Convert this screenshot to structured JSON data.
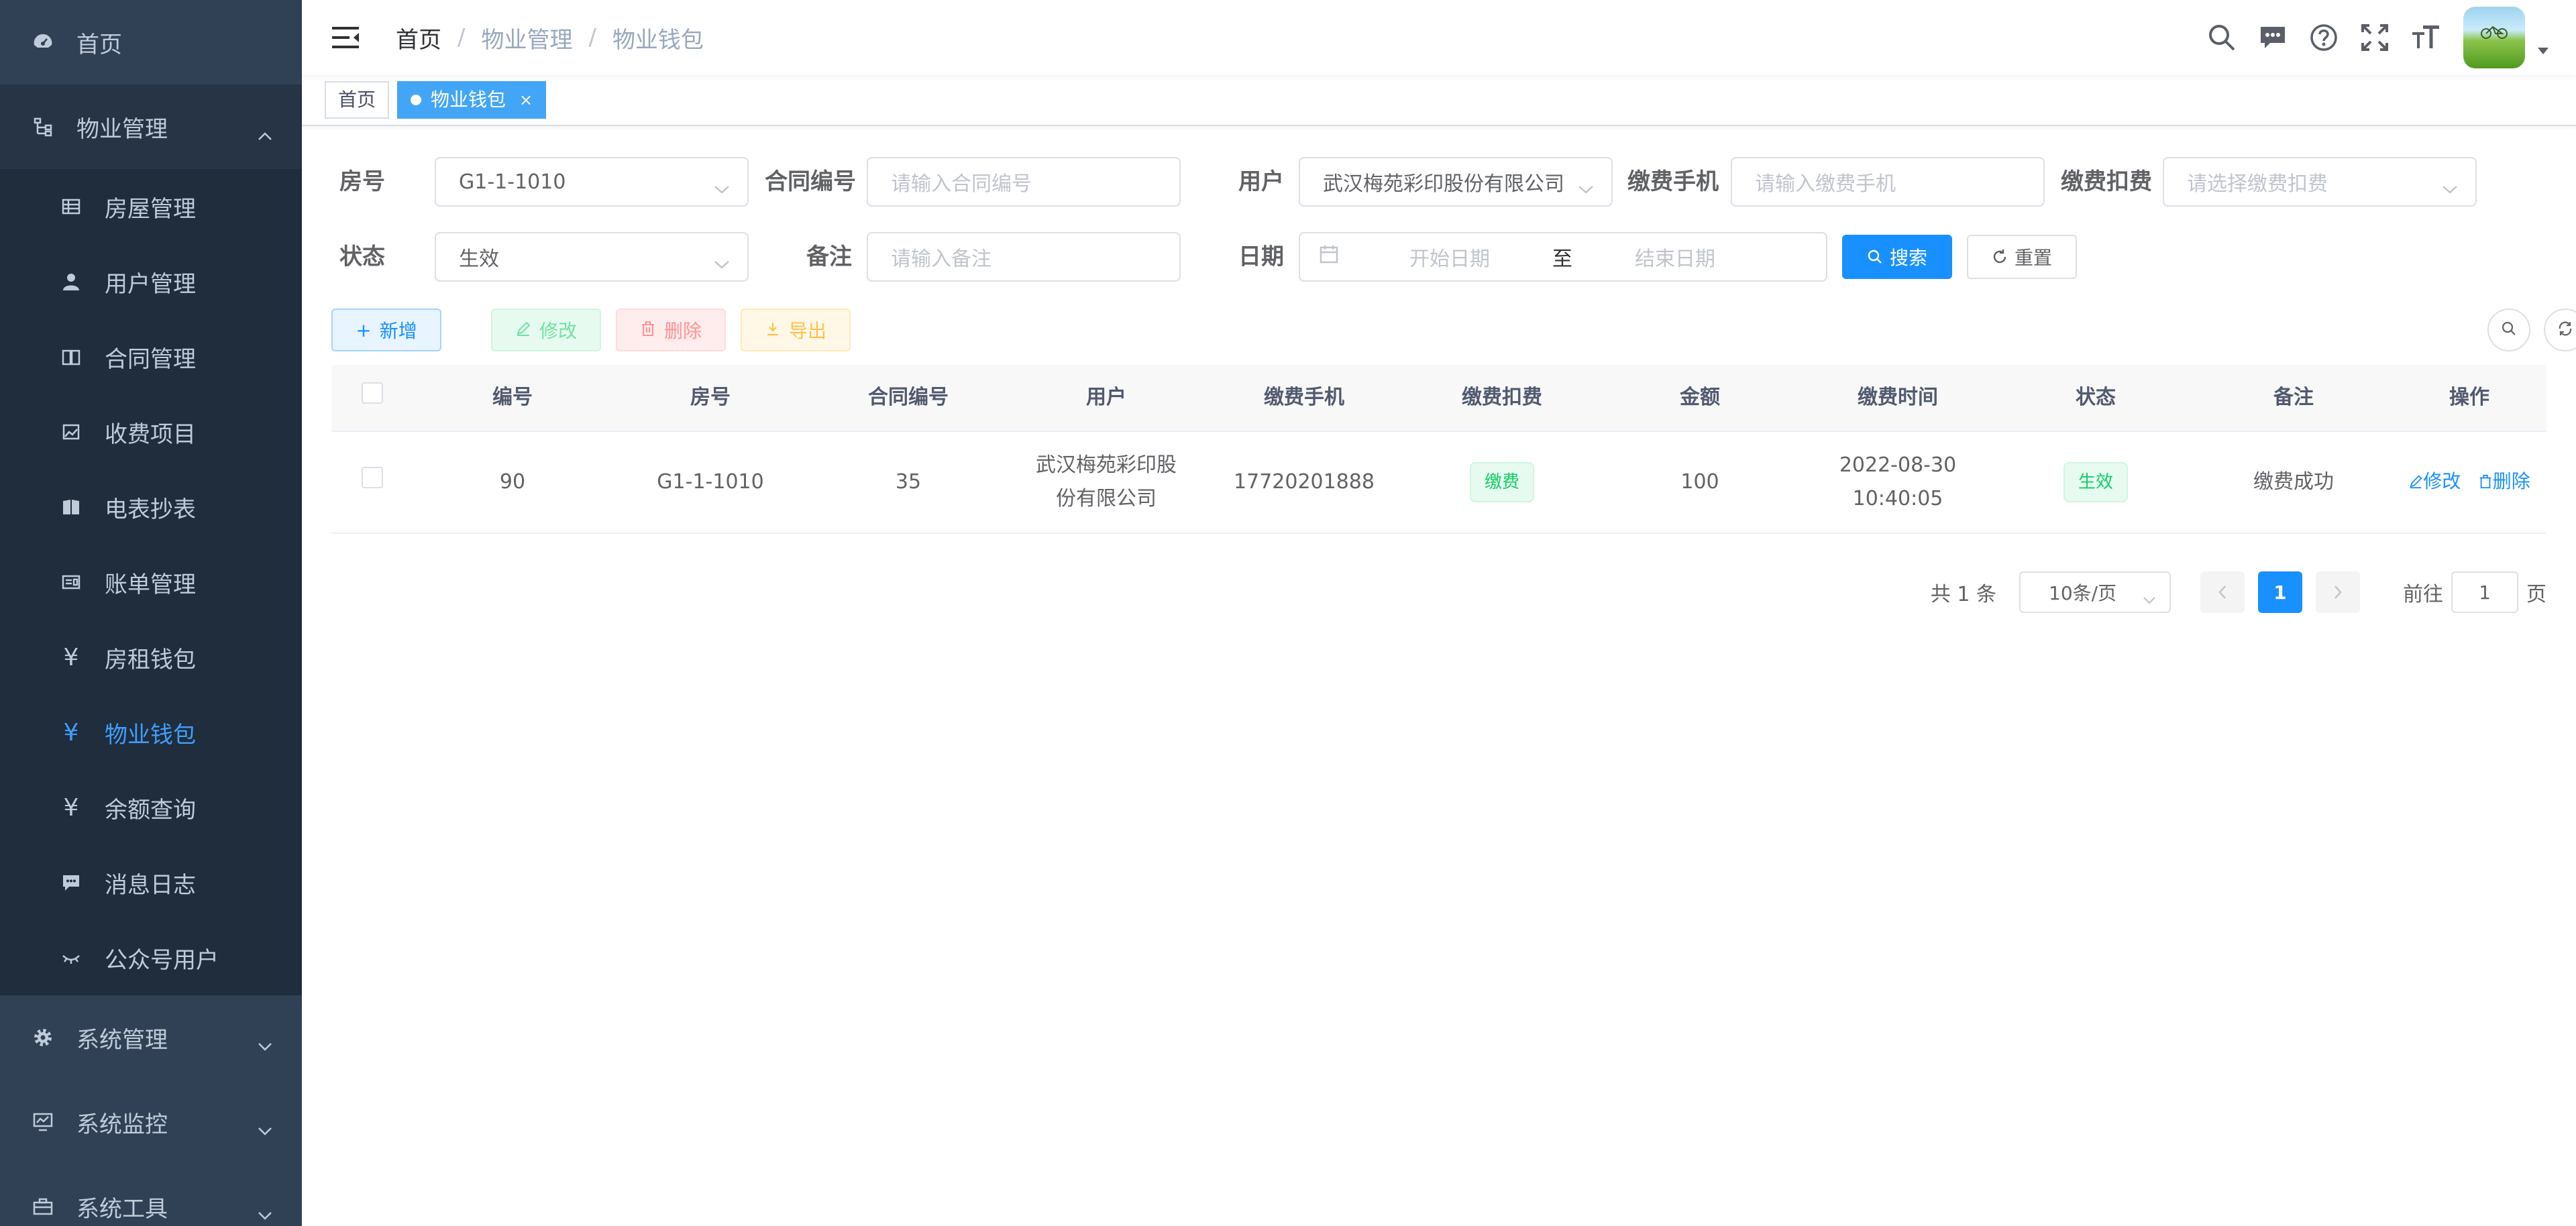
{
  "sidebar": {
    "items": [
      {
        "label": "首页",
        "icon": "dashboard-icon"
      },
      {
        "label": "物业管理",
        "icon": "tree-icon",
        "expanded": true
      },
      {
        "label": "系统管理",
        "icon": "gear-icon"
      },
      {
        "label": "系统监控",
        "icon": "monitor-icon"
      },
      {
        "label": "系统工具",
        "icon": "toolbox-icon"
      }
    ],
    "sub_items": [
      {
        "label": "房屋管理",
        "icon": "table-icon"
      },
      {
        "label": "用户管理",
        "icon": "user-icon"
      },
      {
        "label": "合同管理",
        "icon": "book-icon"
      },
      {
        "label": "收费项目",
        "icon": "image-icon"
      },
      {
        "label": "电表抄表",
        "icon": "reader-icon"
      },
      {
        "label": "账单管理",
        "icon": "bill-icon"
      },
      {
        "label": "房租钱包",
        "icon": "yuan-icon"
      },
      {
        "label": "物业钱包",
        "icon": "yuan-icon",
        "active": true
      },
      {
        "label": "余额查询",
        "icon": "yuan-icon"
      },
      {
        "label": "消息日志",
        "icon": "message-icon"
      },
      {
        "label": "公众号用户",
        "icon": "eye-closed-icon"
      }
    ]
  },
  "navbar": {
    "breadcrumb": [
      "首页",
      "物业管理",
      "物业钱包"
    ],
    "separator": "/"
  },
  "tags": [
    {
      "label": "首页",
      "active": false
    },
    {
      "label": "物业钱包",
      "active": true,
      "close": "×"
    }
  ],
  "filters": {
    "room_label": "房号",
    "room_value": "G1-1-1010",
    "contract_label": "合同编号",
    "contract_placeholder": "请输入合同编号",
    "user_label": "用户",
    "user_value": "武汉梅苑彩印股份有限公司",
    "phone_label": "缴费手机",
    "phone_placeholder": "请输入缴费手机",
    "deduct_label": "缴费扣费",
    "deduct_placeholder": "请选择缴费扣费",
    "status_label": "状态",
    "status_value": "生效",
    "remark_label": "备注",
    "remark_placeholder": "请输入备注",
    "date_label": "日期",
    "date_start": "开始日期",
    "date_to": "至",
    "date_end": "结束日期",
    "search_label": "搜索",
    "reset_label": "重置"
  },
  "toolbar": {
    "add": "新增",
    "edit": "修改",
    "delete": "删除",
    "export": "导出"
  },
  "table": {
    "columns": [
      "编号",
      "房号",
      "合同编号",
      "用户",
      "缴费手机",
      "缴费扣费",
      "金额",
      "缴费时间",
      "状态",
      "备注",
      "操作"
    ],
    "rows": [
      {
        "id": "90",
        "room": "G1-1-1010",
        "contract": "35",
        "user_line1": "武汉梅苑彩印股",
        "user_line2": "份有限公司",
        "phone": "17720201888",
        "deduct": "缴费",
        "amount": "100",
        "time_line1": "2022-08-30",
        "time_line2": "10:40:05",
        "status": "生效",
        "remark": "缴费成功",
        "op_edit": "修改",
        "op_delete": "删除"
      }
    ]
  },
  "pagination": {
    "total": "共 1 条",
    "page_size": "10条/页",
    "current": "1",
    "goto_prefix": "前往",
    "goto_value": "1",
    "goto_suffix": "页"
  },
  "colors": {
    "sidebar_bg": "#304156",
    "submenu_bg": "#1f2d3d",
    "accent": "#1890ff",
    "tag_active": "#42a5f5",
    "success": "#13ce66"
  }
}
